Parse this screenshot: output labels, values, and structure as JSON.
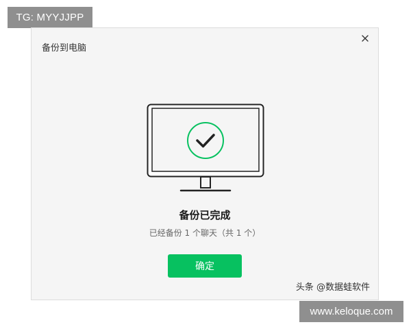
{
  "overlay": {
    "tg_badge": "TG: MYYJJPP",
    "site_watermark": "www.keloque.com"
  },
  "dialog": {
    "title": "备份到电脑",
    "close_icon": "close-icon",
    "illustration": "monitor-with-checkmark",
    "status_title": "备份已完成",
    "status_detail": "已经备份 1 个聊天（共 1 个）",
    "confirm_label": "确定",
    "watermark": "头条 @数据蛙软件"
  },
  "colors": {
    "accent": "#07c160",
    "dialog_bg": "#f5f5f5",
    "badge_bg": "#8f8f8f"
  }
}
